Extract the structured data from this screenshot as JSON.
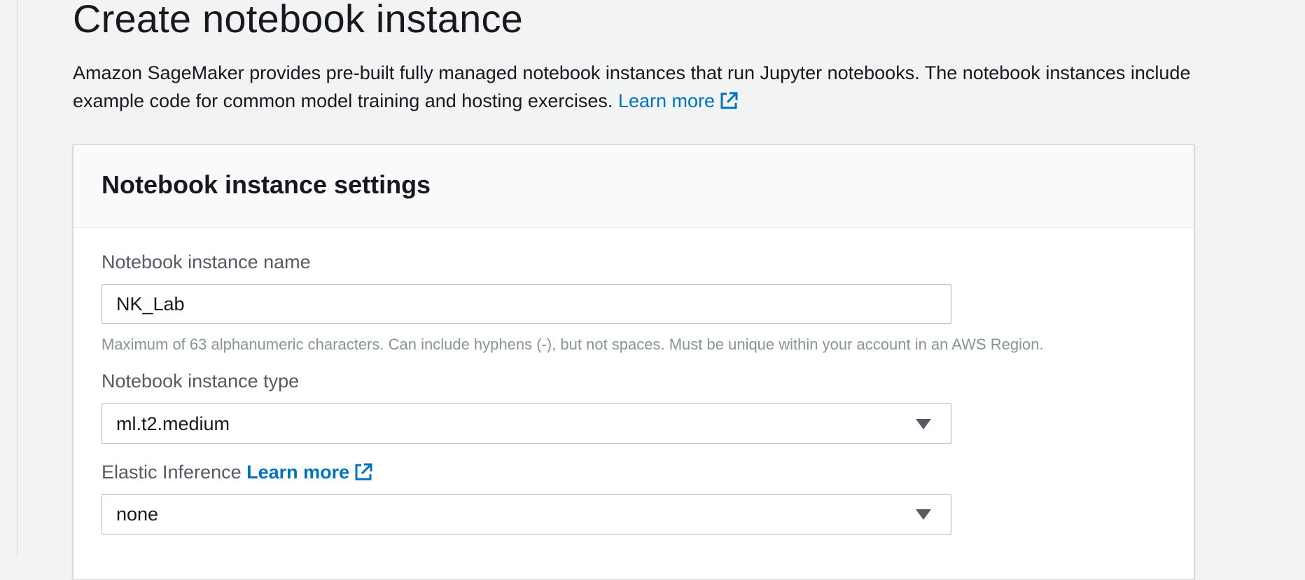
{
  "page": {
    "title": "Create notebook instance",
    "description": "Amazon SageMaker provides pre-built fully managed notebook instances that run Jupyter notebooks. The notebook instances include example code for common model training and hosting exercises.",
    "learn_more": "Learn more"
  },
  "panel": {
    "title": "Notebook instance settings",
    "name_field": {
      "label": "Notebook instance name",
      "value": "NK_Lab",
      "hint": "Maximum of 63 alphanumeric characters. Can include hyphens (-), but not spaces. Must be unique within your account in an AWS Region."
    },
    "type_field": {
      "label": "Notebook instance type",
      "selected": "ml.t2.medium"
    },
    "elastic_field": {
      "label": "Elastic Inference",
      "learn_more": "Learn more",
      "selected": "none"
    }
  },
  "colors": {
    "background": "#f2f3f3",
    "link": "#0073bb",
    "text": "#16191f",
    "label": "#545b64",
    "hint": "#879596",
    "border": "#aab7b8"
  },
  "icons": [
    "external-link-icon",
    "dropdown-caret-icon"
  ]
}
